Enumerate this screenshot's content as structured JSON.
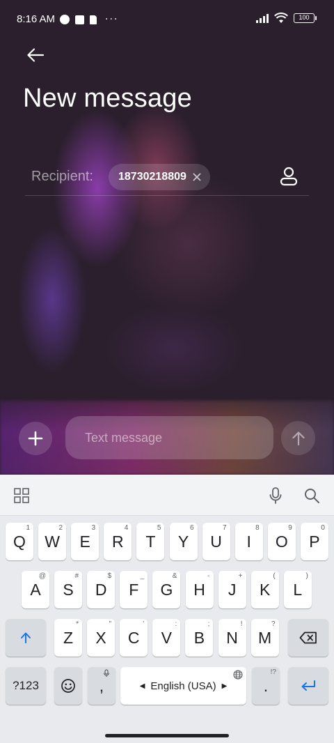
{
  "status_bar": {
    "time": "8:16 AM",
    "battery": "100",
    "more": "···"
  },
  "header": {
    "title": "New message",
    "back_icon": "arrow-left-icon"
  },
  "recipient": {
    "label": "Recipient:",
    "chip": "18730218809"
  },
  "composer": {
    "placeholder": "Text message"
  },
  "colors": {
    "accent": "#1a73e8",
    "keyboard_bg": "#e8eaed",
    "key_bg": "#ffffff",
    "special_key_bg": "#d8dbe0"
  },
  "keyboard": {
    "row1": [
      {
        "label": "Q",
        "hint": "1"
      },
      {
        "label": "W",
        "hint": "2"
      },
      {
        "label": "E",
        "hint": "3"
      },
      {
        "label": "R",
        "hint": "4"
      },
      {
        "label": "T",
        "hint": "5"
      },
      {
        "label": "Y",
        "hint": "6"
      },
      {
        "label": "U",
        "hint": "7"
      },
      {
        "label": "I",
        "hint": "8"
      },
      {
        "label": "O",
        "hint": "9"
      },
      {
        "label": "P",
        "hint": "0"
      }
    ],
    "row2": [
      {
        "label": "A",
        "hint": "@"
      },
      {
        "label": "S",
        "hint": "#"
      },
      {
        "label": "D",
        "hint": "$"
      },
      {
        "label": "F",
        "hint": "_"
      },
      {
        "label": "G",
        "hint": "&"
      },
      {
        "label": "H",
        "hint": "-"
      },
      {
        "label": "J",
        "hint": "+"
      },
      {
        "label": "K",
        "hint": "("
      },
      {
        "label": "L",
        "hint": ")"
      }
    ],
    "row3": [
      {
        "label": "Z",
        "hint": "*"
      },
      {
        "label": "X",
        "hint": "\""
      },
      {
        "label": "C",
        "hint": "'"
      },
      {
        "label": "V",
        "hint": ":"
      },
      {
        "label": "B",
        "hint": ";"
      },
      {
        "label": "N",
        "hint": "!"
      },
      {
        "label": "M",
        "hint": "?"
      }
    ],
    "symbols_key": "?123",
    "comma_key": ",",
    "period_key": ".",
    "period_hint": "!?",
    "space_label": "English (USA)"
  }
}
